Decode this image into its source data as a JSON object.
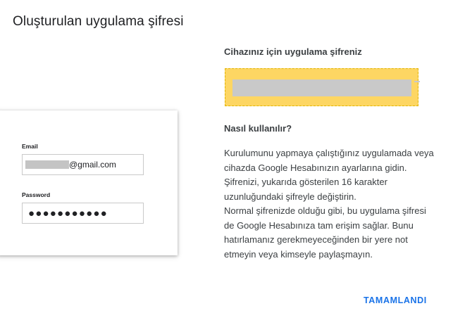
{
  "dialog": {
    "title": "Oluşturulan uygulama şifresi",
    "done_label": "TAMAMLANDI"
  },
  "sample_login": {
    "email_label": "Email",
    "email_value_suffix": "@gmail.com",
    "password_label": "Password",
    "password_dots": "●●●●●●●●●●●"
  },
  "app_password": {
    "heading": "Cihazınız için uygulama şifreniz"
  },
  "how_to": {
    "heading": "Nasıl kullanılır?",
    "text": "Kurulumunu yapmaya çalıştığınız uygulamada veya cihazda Google Hesabınızın ayarlarına gidin. Şifrenizi, yukarıda gösterilen 16 karakter uzunluğundaki şifreyle değiştirin.\nNormal şifrenizde olduğu gibi, bu uygulama şifresi de Google Hesabınıza tam erişim sağlar. Bunu hatırlamanız gerekmeyeceğinden bir yere not etmeyin veya kimseyle paylaşmayın."
  },
  "colors": {
    "accent": "#1a73e8",
    "password_panel": "#fdd663"
  }
}
